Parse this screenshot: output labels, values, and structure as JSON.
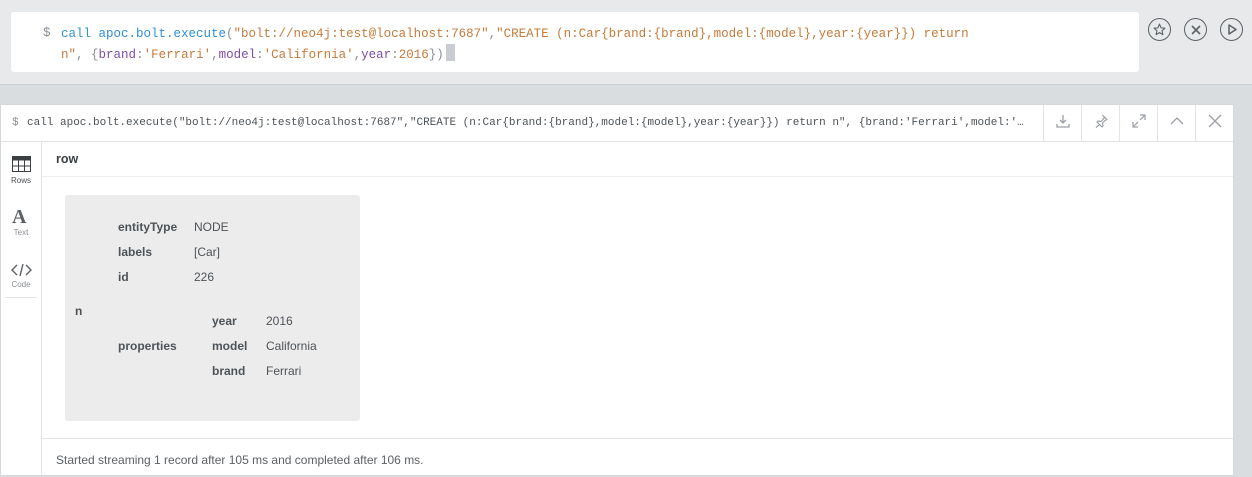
{
  "editor": {
    "prompt": "$",
    "code": {
      "fn": "call apoc.bolt.execute",
      "arg_url": "\"bolt://neo4j:test@localhost:7687\"",
      "arg_query_line1": "\"CREATE (n:Car{brand:{brand},model:{model},year:{year}}) return",
      "arg_query_line2": "n\"",
      "params_open": "{",
      "p_brand_key": "brand",
      "p_brand_val": "'Ferrari'",
      "p_model_key": "model",
      "p_model_val": "'California'",
      "p_year_key": "year",
      "p_year_val": "2016",
      "params_close": "})"
    },
    "actions": [
      "star-icon",
      "close-circle-icon",
      "play-icon"
    ]
  },
  "frame": {
    "prompt": "$",
    "query": "call apoc.bolt.execute(\"bolt://neo4j:test@localhost:7687\",\"CREATE (n:Car{brand:{brand},model:{model},year:{year}}) return n\", {brand:'Ferrari',model:'C…",
    "tools": [
      "download-icon",
      "pin-icon",
      "expand-icon",
      "collapse-icon",
      "close-icon"
    ]
  },
  "views": [
    {
      "label": "Rows",
      "icon": "table-icon",
      "active": true
    },
    {
      "label": "Text",
      "icon": "text-icon",
      "active": false
    },
    {
      "label": "Code",
      "icon": "code-icon",
      "active": false
    }
  ],
  "table": {
    "column": "row",
    "var": "n",
    "entity": {
      "entityType_key": "entityType",
      "entityType_val": "NODE",
      "labels_key": "labels",
      "labels_val": "[Car]",
      "id_key": "id",
      "id_val": "226",
      "properties_key": "properties",
      "properties": [
        {
          "key": "year",
          "value": "2016"
        },
        {
          "key": "model",
          "value": "California"
        },
        {
          "key": "brand",
          "value": "Ferrari"
        }
      ]
    }
  },
  "status": "Started streaming 1 record after 105 ms and completed after 106 ms."
}
